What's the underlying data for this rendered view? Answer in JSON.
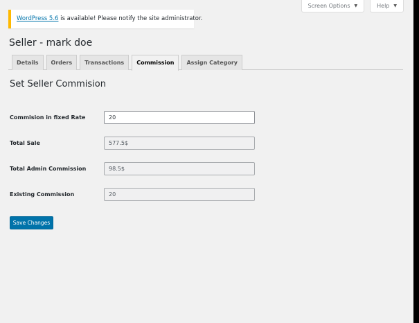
{
  "screen_meta": {
    "screen_options_label": "Screen Options",
    "help_label": "Help",
    "caret": "▼"
  },
  "notice": {
    "link_text": "WordPress 5.6",
    "message": " is available! Please notify the site administrator.",
    "accent_color": "#ffb900"
  },
  "page_title": "Seller - mark doe",
  "tabs": [
    {
      "label": "Details",
      "active": false
    },
    {
      "label": "Orders",
      "active": false
    },
    {
      "label": "Transactions",
      "active": false
    },
    {
      "label": "Commission",
      "active": true
    },
    {
      "label": "Assign Category",
      "active": false
    }
  ],
  "section_title": "Set Seller Commision",
  "fields": [
    {
      "label": "Commision in fixed Rate",
      "value": "20",
      "editable": true
    },
    {
      "label": "Total Sale",
      "value": "577.5$",
      "editable": false
    },
    {
      "label": "Total Admin Commission",
      "value": "98.5$",
      "editable": false
    },
    {
      "label": "Existing Commission",
      "value": "20",
      "editable": false
    }
  ],
  "save_button_label": "Save Changes",
  "colors": {
    "primary": "#0073aa",
    "background": "#f1f1f1"
  }
}
